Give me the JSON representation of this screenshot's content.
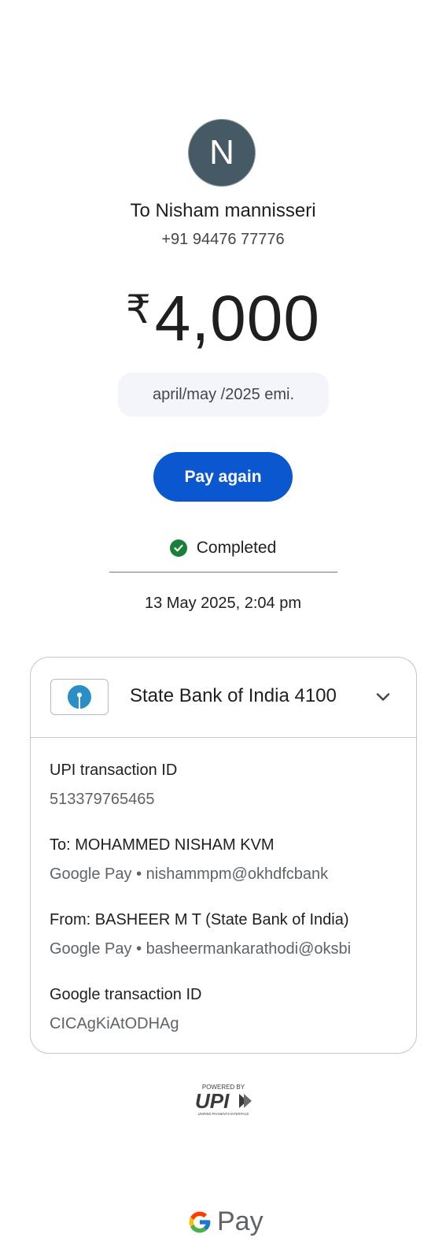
{
  "recipient": {
    "initial": "N",
    "name": "To Nisham mannisseri",
    "phone": "+91 94476 77776"
  },
  "payment": {
    "currency_symbol": "₹",
    "amount": "4,000",
    "note": "april/may /2025 emi.",
    "pay_again_label": "Pay again",
    "status": "Completed",
    "datetime": "13 May 2025, 2:04 pm"
  },
  "bank": {
    "name": "State Bank of India 4100",
    "icon": "sbi-logo"
  },
  "details": [
    {
      "label": "UPI transaction ID",
      "value": "513379765465"
    },
    {
      "label": "To: MOHAMMED NISHAM KVM",
      "value": "Google Pay • nishammpm@okhdfcbank"
    },
    {
      "label": "From: BASHEER  M T (State Bank of India)",
      "value": "Google Pay • basheermankarathodi@oksbi"
    },
    {
      "label": "Google transaction ID",
      "value": "CICAgKiAtODHAg"
    }
  ],
  "footer": {
    "powered_by": "POWERED BY",
    "upi_word": "UPI",
    "upi_tagline": "UNIFIED PAYMENTS INTERFACE",
    "gpay_word": "Pay"
  },
  "colors": {
    "accent": "#0b57d0",
    "success": "#188038",
    "avatar_bg": "#465a66",
    "sbi_blue": "#2a8fc4"
  }
}
